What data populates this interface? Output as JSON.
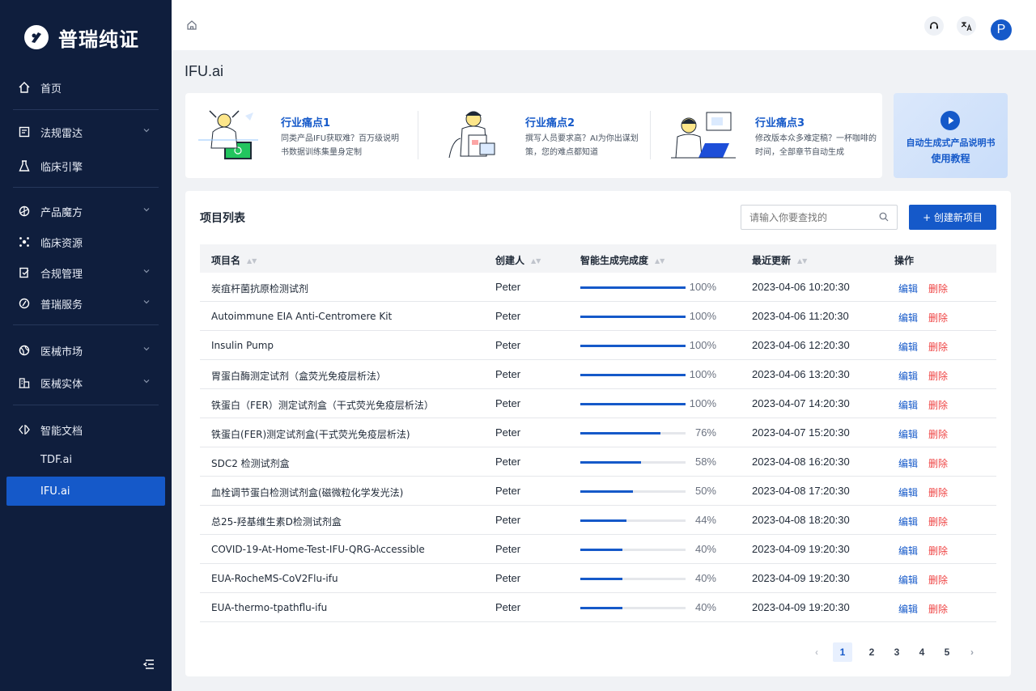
{
  "brand": {
    "name": "普瑞纯证"
  },
  "sidebar": {
    "items": [
      {
        "label": "首页",
        "icon": "home-icon"
      },
      {
        "label": "法规雷达",
        "icon": "radar-icon",
        "expandable": true
      },
      {
        "label": "临床引擎",
        "icon": "flask-icon"
      },
      {
        "label": "产品魔方",
        "icon": "cube-icon",
        "expandable": true
      },
      {
        "label": "临床资源",
        "icon": "resource-icon"
      },
      {
        "label": "合规管理",
        "icon": "compliance-icon",
        "expandable": true
      },
      {
        "label": "普瑞服务",
        "icon": "service-icon",
        "expandable": true
      },
      {
        "label": "医械市场",
        "icon": "market-icon",
        "expandable": true
      },
      {
        "label": "医械实体",
        "icon": "entity-icon",
        "expandable": true
      },
      {
        "label": "智能文档",
        "icon": "document-icon"
      }
    ],
    "subitems": [
      {
        "label": "TDF.ai"
      },
      {
        "label": "IFU.ai",
        "active": true
      }
    ]
  },
  "page": {
    "title": "IFU.ai"
  },
  "pains": [
    {
      "title": "行业痛点1",
      "desc": "同类产品IFU获取难？百万级说明书数据训练集量身定制"
    },
    {
      "title": "行业痛点2",
      "desc": "撰写人员要求高？AI为你出谋划策，您的难点都知道"
    },
    {
      "title": "行业痛点3",
      "desc": "修改版本众多难定稿？一杯咖啡的时间，全部章节自动生成"
    }
  ],
  "tutorial": {
    "line1": "自动生成式产品说明书",
    "line2": "使用教程"
  },
  "list": {
    "title": "项目列表",
    "search_placeholder": "请输入你要查找的",
    "new_button": "+ 创建新项目",
    "columns": {
      "name": "项目名",
      "creator": "创建人",
      "progress": "智能生成完成度",
      "updated": "最近更新",
      "actions": "操作"
    },
    "edit_label": "编辑",
    "delete_label": "删除",
    "rows": [
      {
        "name": "炭疽杆菌抗原检测试剂",
        "creator": "Peter",
        "progress": 100,
        "progress_text": "100%",
        "updated": "2023-04-06 10:20:30"
      },
      {
        "name": "Autoimmune EIA Anti-Centromere Kit",
        "creator": "Peter",
        "progress": 100,
        "progress_text": "100%",
        "updated": "2023-04-06 11:20:30"
      },
      {
        "name": "Insulin Pump",
        "creator": "Peter",
        "progress": 100,
        "progress_text": "100%",
        "updated": "2023-04-06 12:20:30"
      },
      {
        "name": "胃蛋白酶测定试剂（盒荧光免疫层析法）",
        "creator": "Peter",
        "progress": 100,
        "progress_text": "100%",
        "updated": "2023-04-06 13:20:30"
      },
      {
        "name": "铁蛋白（FER）测定试剂盒（干式荧光免疫层析法）",
        "creator": "Peter",
        "progress": 100,
        "progress_text": "100%",
        "updated": "2023-04-07 14:20:30"
      },
      {
        "name": "铁蛋白(FER)测定试剂盒(干式荧光免疫层析法)",
        "creator": "Peter",
        "progress": 76,
        "progress_text": "76%",
        "updated": "2023-04-07 15:20:30"
      },
      {
        "name": "SDC2 检测试剂盒",
        "creator": "Peter",
        "progress": 58,
        "progress_text": "58%",
        "updated": "2023-04-08 16:20:30"
      },
      {
        "name": "血栓调节蛋白检测试剂盒(磁微粒化学发光法)",
        "creator": "Peter",
        "progress": 50,
        "progress_text": "50%",
        "updated": "2023-04-08 17:20:30"
      },
      {
        "name": "总25-羟基维生素D检测试剂盒",
        "creator": "Peter",
        "progress": 44,
        "progress_text": "44%",
        "updated": "2023-04-08 18:20:30"
      },
      {
        "name": "COVID-19-At-Home-Test-IFU-QRG-Accessible",
        "creator": "Peter",
        "progress": 40,
        "progress_text": "40%",
        "updated": "2023-04-09 19:20:30"
      },
      {
        "name": "EUA-RocheMS-CoV2Flu-ifu",
        "creator": "Peter",
        "progress": 40,
        "progress_text": "40%",
        "updated": "2023-04-09 19:20:30"
      },
      {
        "name": "EUA-thermo-tpathflu-ifu",
        "creator": "Peter",
        "progress": 40,
        "progress_text": "40%",
        "updated": "2023-04-09 19:20:30"
      }
    ]
  },
  "pagination": {
    "pages": [
      "1",
      "2",
      "3",
      "4",
      "5"
    ],
    "current": "1",
    "prev": "‹",
    "next": "›"
  },
  "user": {
    "avatar_letter": "P"
  },
  "colors": {
    "primary": "#1559c9",
    "danger": "#ef4444",
    "sidebar": "#0f1e3d"
  }
}
